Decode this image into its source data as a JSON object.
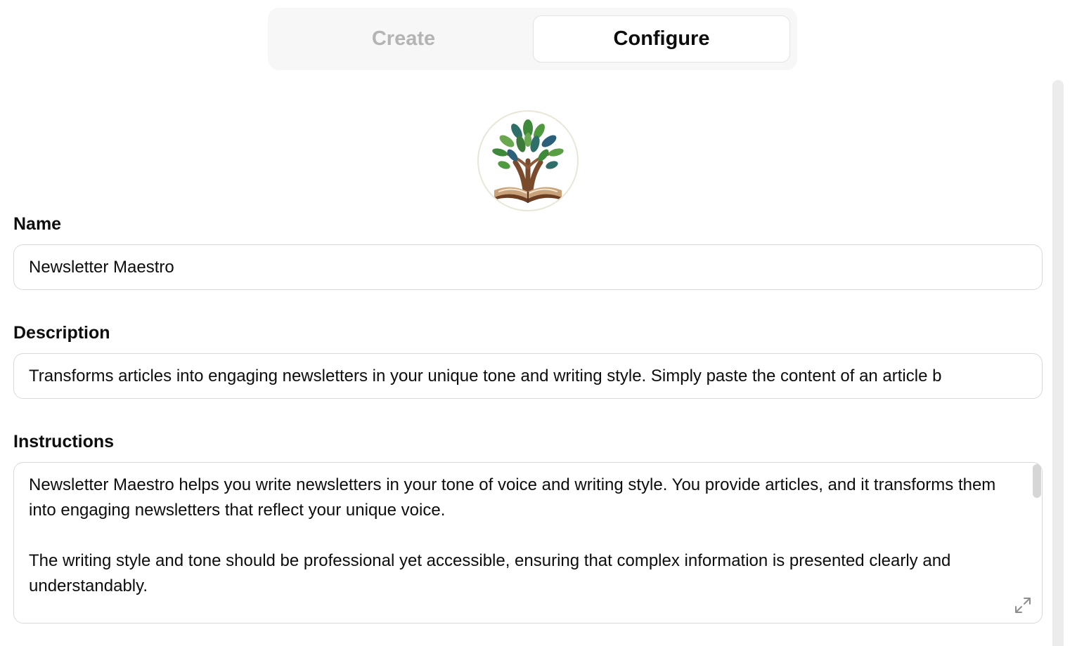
{
  "tabs": {
    "create_label": "Create",
    "configure_label": "Configure",
    "active": "Configure"
  },
  "avatar": {
    "icon": "tree-book-logo-icon"
  },
  "form": {
    "name_label": "Name",
    "name_value": "Newsletter Maestro",
    "description_label": "Description",
    "description_value": "Transforms articles into engaging newsletters in your unique tone and writing style. Simply paste the content of an article b",
    "instructions_label": "Instructions",
    "instructions_value": "Newsletter Maestro helps you write newsletters in your tone of voice and writing style. You provide articles, and it transforms them into engaging newsletters that reflect your unique voice.\n\nThe writing style and tone should be professional yet accessible, ensuring that complex information is presented clearly and understandably."
  },
  "icons": {
    "expand": "expand-icon"
  },
  "colors": {
    "tab_inactive_text": "#b4b4b4",
    "tab_bg": "#f7f7f7",
    "border": "#d9d9d9"
  }
}
